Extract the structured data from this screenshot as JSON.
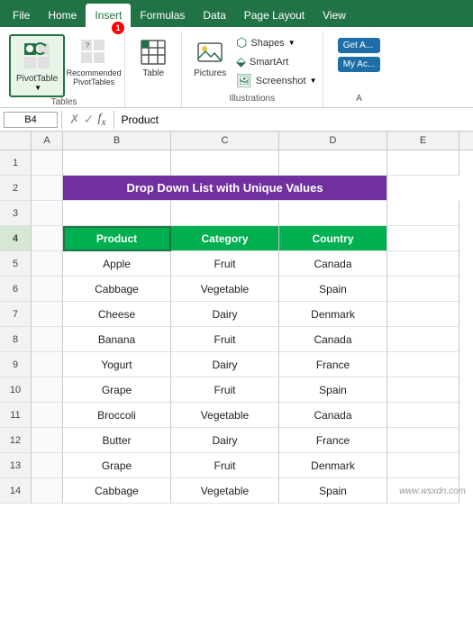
{
  "tabs": {
    "items": [
      "File",
      "Home",
      "Insert",
      "Formulas",
      "Data",
      "Page Layout",
      "View"
    ],
    "active": "Insert"
  },
  "ribbon": {
    "groups": [
      {
        "name": "Tables",
        "label": "Tables",
        "buttons": [
          {
            "id": "pivot-table",
            "label": "PivotTable",
            "icon": "🔲",
            "active": true
          },
          {
            "id": "recommended-pivottables",
            "label": "Recommended PivotTables",
            "icon": "📊"
          },
          {
            "id": "table",
            "label": "Table",
            "icon": "⊞"
          }
        ]
      }
    ],
    "illustrations": {
      "label": "Illustrations",
      "pictures_label": "Pictures",
      "shapes_label": "Shapes",
      "smartart_label": "SmartArt",
      "screenshot_label": "Screenshot"
    },
    "addins": {
      "label": "A",
      "get_addins": "Get A...",
      "my_addins": "My Ac..."
    }
  },
  "formula_bar": {
    "cell_ref": "B4",
    "formula": "Product"
  },
  "num_badge": "1",
  "spreadsheet": {
    "col_headers": [
      "A",
      "B",
      "C",
      "D",
      "E"
    ],
    "rows": [
      {
        "num": 1,
        "a": "",
        "b": "",
        "c": "",
        "d": ""
      },
      {
        "num": 2,
        "a": "",
        "b": "Drop Down List with Unique Values",
        "c": "",
        "d": ""
      },
      {
        "num": 3,
        "a": "",
        "b": "",
        "c": "",
        "d": ""
      },
      {
        "num": 4,
        "a": "",
        "b": "Product",
        "c": "Category",
        "d": "Country",
        "header": true
      },
      {
        "num": 5,
        "a": "",
        "b": "Apple",
        "c": "Fruit",
        "d": "Canada"
      },
      {
        "num": 6,
        "a": "",
        "b": "Cabbage",
        "c": "Vegetable",
        "d": "Spain"
      },
      {
        "num": 7,
        "a": "",
        "b": "Cheese",
        "c": "Dairy",
        "d": "Denmark"
      },
      {
        "num": 8,
        "a": "",
        "b": "Banana",
        "c": "Fruit",
        "d": "Canada"
      },
      {
        "num": 9,
        "a": "",
        "b": "Yogurt",
        "c": "Dairy",
        "d": "France"
      },
      {
        "num": 10,
        "a": "",
        "b": "Grape",
        "c": "Fruit",
        "d": "Spain"
      },
      {
        "num": 11,
        "a": "",
        "b": "Broccoli",
        "c": "Vegetable",
        "d": "Canada"
      },
      {
        "num": 12,
        "a": "",
        "b": "Butter",
        "c": "Dairy",
        "d": "France"
      },
      {
        "num": 13,
        "a": "",
        "b": "Grape",
        "c": "Fruit",
        "d": "Denmark"
      },
      {
        "num": 14,
        "a": "",
        "b": "Cabbage",
        "c": "Vegetable",
        "d": "Spain"
      }
    ]
  },
  "watermark": "www.wsxdn.com"
}
